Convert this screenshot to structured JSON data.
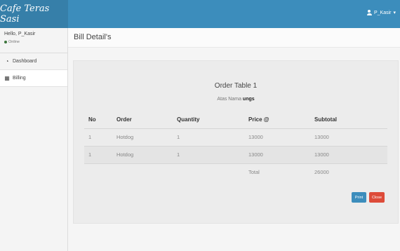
{
  "app": {
    "brand": "Cafe Teras Sasi"
  },
  "header": {
    "user_name": "P_Kasir",
    "user_caret": "▾"
  },
  "sidebar": {
    "greeting": "Hello, P_Kasir",
    "status": "Online",
    "items": [
      {
        "label": "Dashboard",
        "icon": "dashboard-icon",
        "active": false
      },
      {
        "label": "Billing",
        "icon": "grid-icon",
        "active": true
      }
    ]
  },
  "page": {
    "title": "Bill Detail's"
  },
  "bill": {
    "title": "Order Table 1",
    "atas_nama_label": "Atas Nama",
    "customer": "ungs",
    "columns": [
      "No",
      "Order",
      "Quantity",
      "Price @",
      "Subtotal"
    ],
    "rows": [
      {
        "no": "1",
        "order": "Hotdog",
        "quantity": "1",
        "price": "13000",
        "subtotal": "13000"
      },
      {
        "no": "1",
        "order": "Hotdog",
        "quantity": "1",
        "price": "13000",
        "subtotal": "13000"
      }
    ],
    "total_label": "Total",
    "total_value": "26000",
    "print_label": "Print",
    "close_label": "Close"
  },
  "colors": {
    "brand": "#367fa9",
    "header": "#3c8dbc",
    "print": "#3c8dbc",
    "close": "#dd4b39"
  }
}
